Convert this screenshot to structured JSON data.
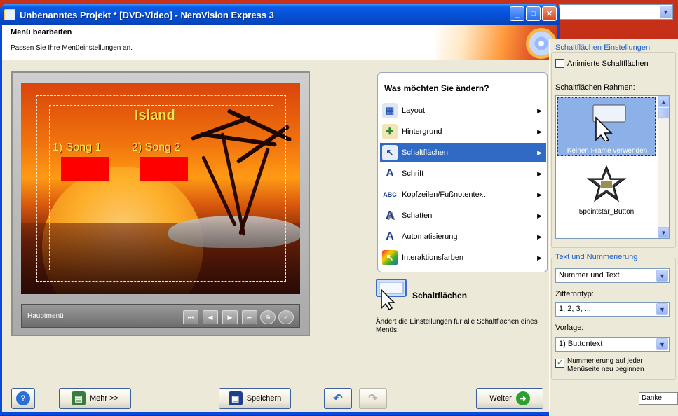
{
  "window": {
    "title": "Unbenanntes Projekt * [DVD-Video] - NeroVision Express 3"
  },
  "header": {
    "title": "Menü bearbeiten",
    "subtitle": "Passen Sie Ihre Menüeinstellungen an."
  },
  "preview": {
    "menu_title": "Island",
    "songs": [
      "1) Song 1",
      "2) Song 2"
    ],
    "bar_label": "Hauptmenü"
  },
  "menu_panel": {
    "heading": "Was möchten Sie ändern?",
    "items": [
      {
        "label": "Layout",
        "icon": "layout-icon",
        "selected": false
      },
      {
        "label": "Hintergrund",
        "icon": "background-icon",
        "selected": false
      },
      {
        "label": "Schaltflächen",
        "icon": "buttons-icon",
        "selected": true
      },
      {
        "label": "Schrift",
        "icon": "font-icon",
        "selected": false
      },
      {
        "label": "Kopfzeilen/Fußnotentext",
        "icon": "header-footer-icon",
        "selected": false
      },
      {
        "label": "Schatten",
        "icon": "shadow-icon",
        "selected": false
      },
      {
        "label": "Automatisierung",
        "icon": "automation-icon",
        "selected": false
      },
      {
        "label": "Interaktionsfarben",
        "icon": "interaction-colors-icon",
        "selected": false
      }
    ]
  },
  "selection": {
    "title": "Schaltflächen",
    "description": "Ändert die Einstellungen für alle Schaltflächen eines Menüs."
  },
  "buttons": {
    "more": "Mehr >>",
    "save": "Speichern",
    "next": "Weiter"
  },
  "settings": {
    "group1_title": "Schaltflächen Einstellungen",
    "animated_label": "Animierte Schaltflächen",
    "animated_checked": false,
    "frame_label": "Schaltflächen Rahmen:",
    "frames": [
      "Keinen Frame verwenden",
      "5pointstar_Button"
    ],
    "group2_title": "Text und Nummerierung",
    "text_mode": "Nummer und Text",
    "digit_type_label": "Ziffernntyp:",
    "digit_type": "1, 2, 3, ...",
    "template_label": "Vorlage:",
    "template": "1) Buttontext",
    "renumber_label": "Nummerierung auf jeder Menüseite neu beginnen",
    "renumber_checked": true
  },
  "taskbar": {
    "item": "Danke"
  },
  "colors": {
    "title_blue": "#0a5fe8",
    "selection_blue": "#316ac5",
    "menu_title_yellow": "#ffe34d",
    "button_red": "#ff0000"
  }
}
